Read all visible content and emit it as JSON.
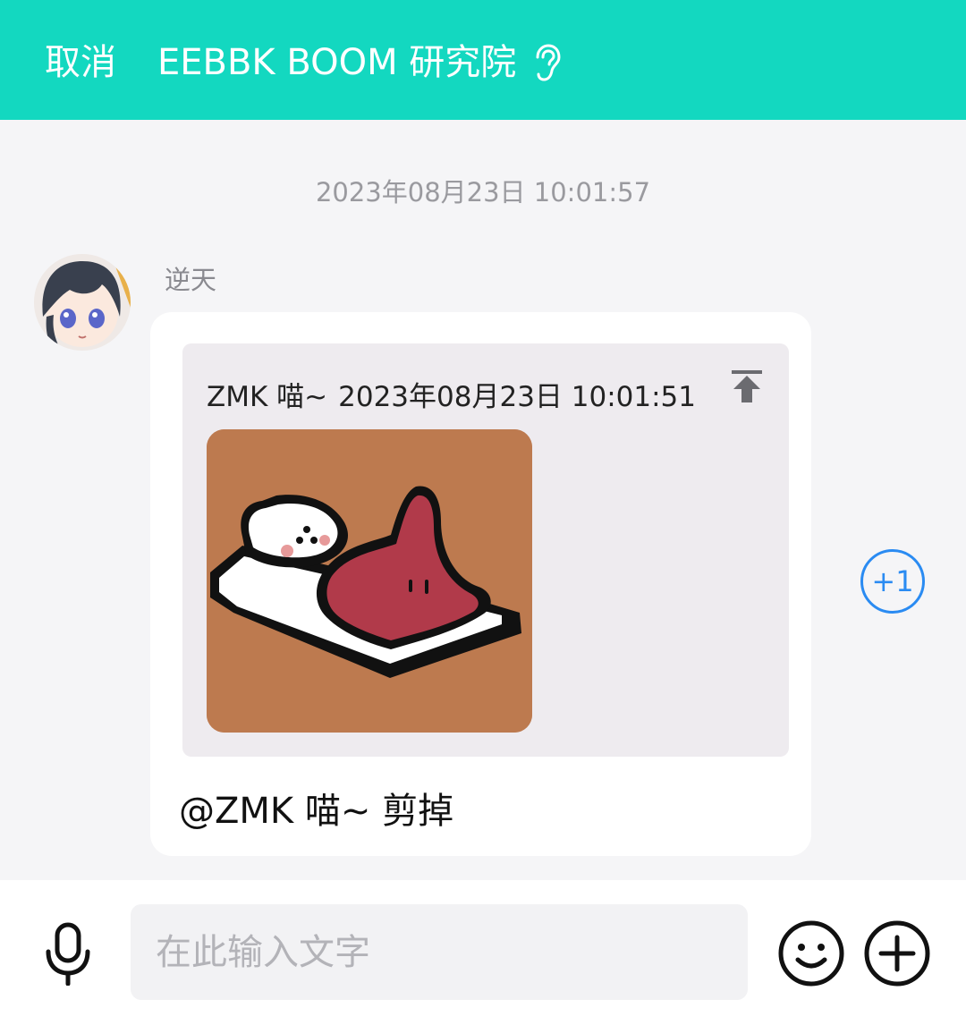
{
  "header": {
    "cancel_label": "取消",
    "title": "EEBBK BOOM 研究院",
    "icon": "ear-icon"
  },
  "chat": {
    "timestamp": "2023年08月23日 10:01:57",
    "message": {
      "sender": "逆天",
      "avatar_icon": "anime-avatar",
      "quote": {
        "author": "ZMK 喵~",
        "time": "2023年08月23日 10:01:51",
        "jump_icon": "jump-to-message-icon",
        "sticker": "cat-in-bed-sticker"
      },
      "text": "@ZMK 喵~ 剪掉"
    },
    "plus_one_label": "+1"
  },
  "input_bar": {
    "placeholder": "在此输入文字",
    "icons": [
      "mic-icon",
      "emoji-icon",
      "plus-icon"
    ]
  },
  "colors": {
    "header_bg": "#13d8c0",
    "accent_blue": "#2a8bf2",
    "background": "#f5f5f7"
  }
}
